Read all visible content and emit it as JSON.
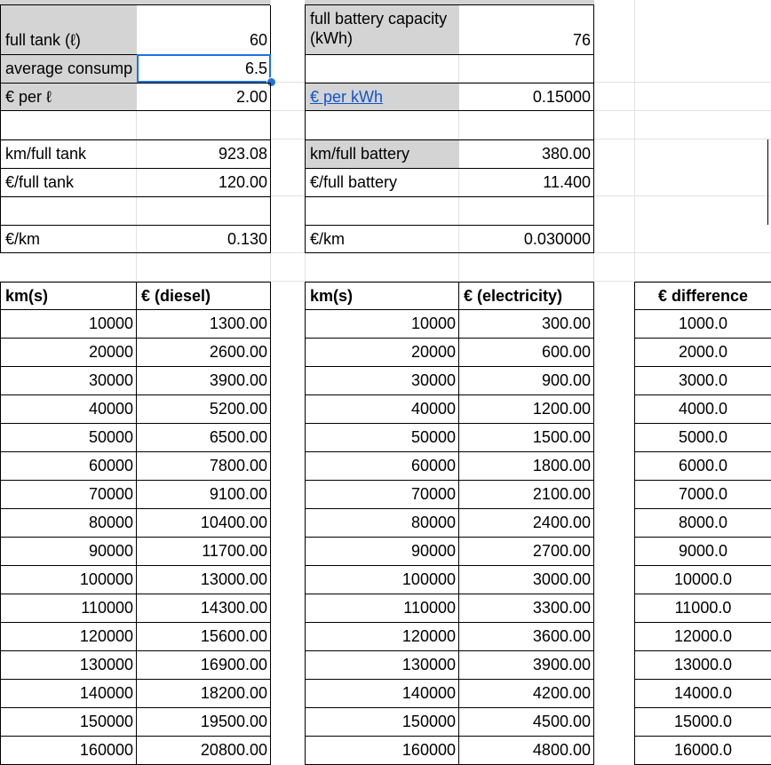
{
  "diesel": {
    "full_tank_label": "full tank (ℓ)",
    "full_tank_value": "60",
    "avg_consumption_label": "average consump",
    "avg_consumption_value": "6.5",
    "price_per_l_label": "€ per ℓ",
    "price_per_l_value": "2.00",
    "km_full_tank_label": "km/full tank",
    "km_full_tank_value": "923.08",
    "eur_full_tank_label": "€/full tank",
    "eur_full_tank_value": "120.00",
    "eur_km_label": "€/km",
    "eur_km_value": "0.130"
  },
  "electric": {
    "capacity_label": "full battery capacity (kWh)",
    "capacity_value": "76",
    "price_per_kwh_label": "€ per kWh",
    "price_per_kwh_value": "0.15000",
    "km_full_battery_label": "km/full battery",
    "km_full_battery_value": "380.00",
    "eur_full_battery_label": "€/full battery",
    "eur_full_battery_value": "11.400",
    "eur_km_label": "€/km",
    "eur_km_value": "0.030000"
  },
  "table": {
    "headers": {
      "km_diesel": "km(s)",
      "eur_diesel": "€ (diesel)",
      "km_electric": "km(s)",
      "eur_electric": "€ (electricity)",
      "difference": "€ difference"
    },
    "rows": [
      {
        "km": "10000",
        "diesel": "1300.00",
        "electric": "300.00",
        "diff": "1000.0"
      },
      {
        "km": "20000",
        "diesel": "2600.00",
        "electric": "600.00",
        "diff": "2000.0"
      },
      {
        "km": "30000",
        "diesel": "3900.00",
        "electric": "900.00",
        "diff": "3000.0"
      },
      {
        "km": "40000",
        "diesel": "5200.00",
        "electric": "1200.00",
        "diff": "4000.0"
      },
      {
        "km": "50000",
        "diesel": "6500.00",
        "electric": "1500.00",
        "diff": "5000.0"
      },
      {
        "km": "60000",
        "diesel": "7800.00",
        "electric": "1800.00",
        "diff": "6000.0"
      },
      {
        "km": "70000",
        "diesel": "9100.00",
        "electric": "2100.00",
        "diff": "7000.0"
      },
      {
        "km": "80000",
        "diesel": "10400.00",
        "electric": "2400.00",
        "diff": "8000.0"
      },
      {
        "km": "90000",
        "diesel": "11700.00",
        "electric": "2700.00",
        "diff": "9000.0"
      },
      {
        "km": "100000",
        "diesel": "13000.00",
        "electric": "3000.00",
        "diff": "10000.0"
      },
      {
        "km": "110000",
        "diesel": "14300.00",
        "electric": "3300.00",
        "diff": "11000.0"
      },
      {
        "km": "120000",
        "diesel": "15600.00",
        "electric": "3600.00",
        "diff": "12000.0"
      },
      {
        "km": "130000",
        "diesel": "16900.00",
        "electric": "3900.00",
        "diff": "13000.0"
      },
      {
        "km": "140000",
        "diesel": "18200.00",
        "electric": "4200.00",
        "diff": "14000.0"
      },
      {
        "km": "150000",
        "diesel": "19500.00",
        "electric": "4500.00",
        "diff": "15000.0"
      },
      {
        "km": "160000",
        "diesel": "20800.00",
        "electric": "4800.00",
        "diff": "16000.0"
      }
    ]
  },
  "colors": {
    "label_fill": "#d4d4d4",
    "selection": "#1a73e8",
    "link": "#1155cc"
  }
}
